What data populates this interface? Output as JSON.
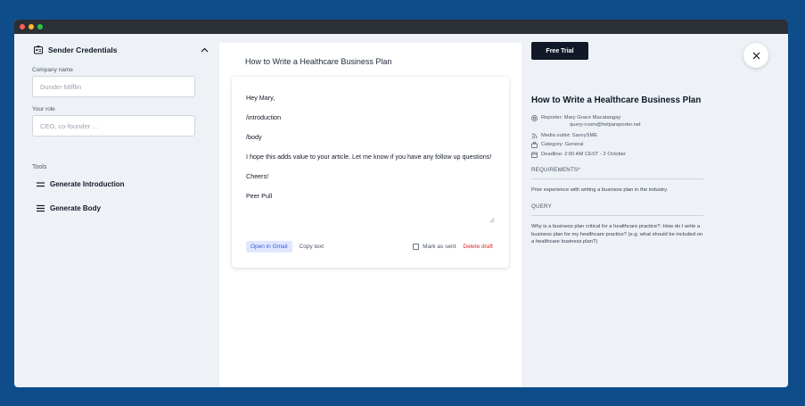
{
  "window": {
    "dot_colors": [
      "#ff5f57",
      "#febc2e",
      "#28c840"
    ]
  },
  "sidebar": {
    "title": "Sender Credentials",
    "company": {
      "label": "Company name",
      "placeholder": "Dunder Mifflin"
    },
    "role": {
      "label": "Your role",
      "placeholder": "CEO, co-founder ..."
    },
    "tools_label": "Tools",
    "tools": [
      {
        "label": "Generate Introduction",
        "icon": "two-lines-icon"
      },
      {
        "label": "Generate Body",
        "icon": "three-lines-icon"
      }
    ]
  },
  "draft": {
    "title": "How to Write a Healthcare Business Plan",
    "paragraphs": [
      "Hey Mary,",
      "/introduction",
      "/body",
      "I hope this adds value to your article. Let me know if you have any follow up questions!",
      "Cheers!",
      "Peer Pull"
    ],
    "open_gmail_label": "Open in Gmail",
    "copy_label": "Copy text",
    "mark_sent_label": "Mark as sent",
    "delete_label": "Delete draft"
  },
  "details": {
    "free_trial_label": "Free Trial",
    "title": "How to Write a Healthcare Business Plan",
    "reporter": "Reporter:  Mary Grace Macatangay",
    "reporter_email": "query-cvsm@helpareporter.net",
    "media_outlet": "Media outlet: SavvySME",
    "category": "Category: General",
    "deadline": "Deadline: 2:00 AM CEST - 2 October",
    "requirements_label": "REQUIREMENTS*",
    "requirements_text": "Prior experience with writing a business plan in the industry.",
    "query_label": "QUERY",
    "query_text": "Why is a business plan critical for a healthcare practice?: How do I write a business plan for my healthcare practice? (e.g. what should be included on a healthcare business plan?)"
  },
  "colors": {
    "background": "#0f4c8a",
    "accent": "#3b5bdb",
    "danger": "#dc2626",
    "dark_button": "#111827"
  }
}
